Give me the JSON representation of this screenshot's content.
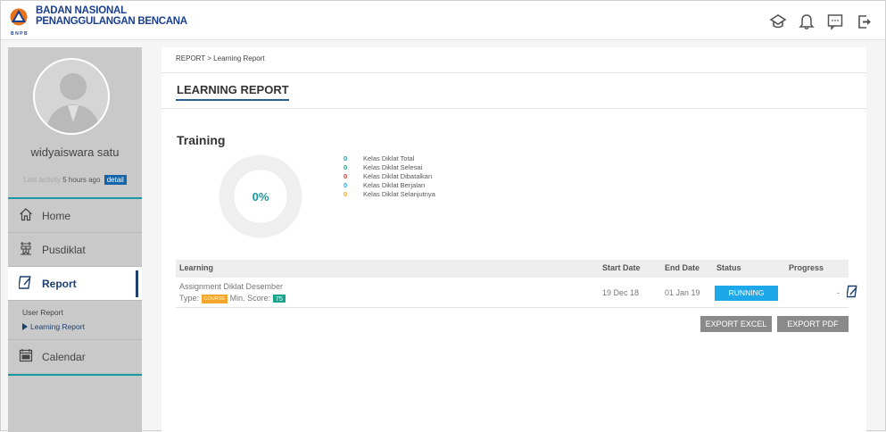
{
  "brand": {
    "line1": "BADAN NASIONAL",
    "line2": "PENANGGULANGAN BENCANA",
    "abbr": "BNPB"
  },
  "topbar_icons": [
    "academy-icon",
    "bell-icon",
    "chat-icon",
    "logout-icon"
  ],
  "user": {
    "name": "widyaiswara satu",
    "last_activity_prefix": "Last activity",
    "last_activity_time": "5 hours ago",
    "detail_label": "detail"
  },
  "nav": {
    "home": "Home",
    "pusdiklat": "Pusdiklat",
    "report": "Report",
    "sub_user_report": "User Report",
    "sub_learning_report": "Learning Report",
    "calendar": "Calendar"
  },
  "breadcrumb": "REPORT  >  Learning Report",
  "page_title": "LEARNING REPORT",
  "section_title": "Training",
  "donut": {
    "percent_label": "0%",
    "fraction": 0
  },
  "legend": [
    {
      "count": "0",
      "label": "Kelas Diklat Total",
      "color": "#1a9aa0"
    },
    {
      "count": "0",
      "label": "Kelas Diklat Selesai",
      "color": "#17a38c"
    },
    {
      "count": "0",
      "label": "Kelas Diklat Dibatalkan",
      "color": "#c0392b"
    },
    {
      "count": "0",
      "label": "Kelas Diklat Berjalan",
      "color": "#1ea8ea"
    },
    {
      "count": "0",
      "label": "Kelas Diklat Selanjutnya",
      "color": "#f4a62a"
    }
  ],
  "table": {
    "headers": {
      "learning": "Learning",
      "start_date": "Start Date",
      "end_date": "End Date",
      "status": "Status",
      "progress": "Progress"
    },
    "rows": [
      {
        "title": "Assignment Diklat Desember",
        "type_label": "Type:",
        "type_badge": "COURSE",
        "min_score_label": "Min. Score:",
        "min_score": "75",
        "start_date": "19 Dec 18",
        "end_date": "01 Jan 19",
        "status": "RUNNING",
        "progress": "-"
      }
    ]
  },
  "buttons": {
    "export_excel": "EXPORT EXCEL",
    "export_pdf": "EXPORT PDF"
  },
  "colors": {
    "brand_blue": "#1a3f8f",
    "teal": "#1b98a3",
    "status_running": "#1ea8ea",
    "course_badge": "#f4a62a",
    "score_badge": "#17a38c"
  }
}
